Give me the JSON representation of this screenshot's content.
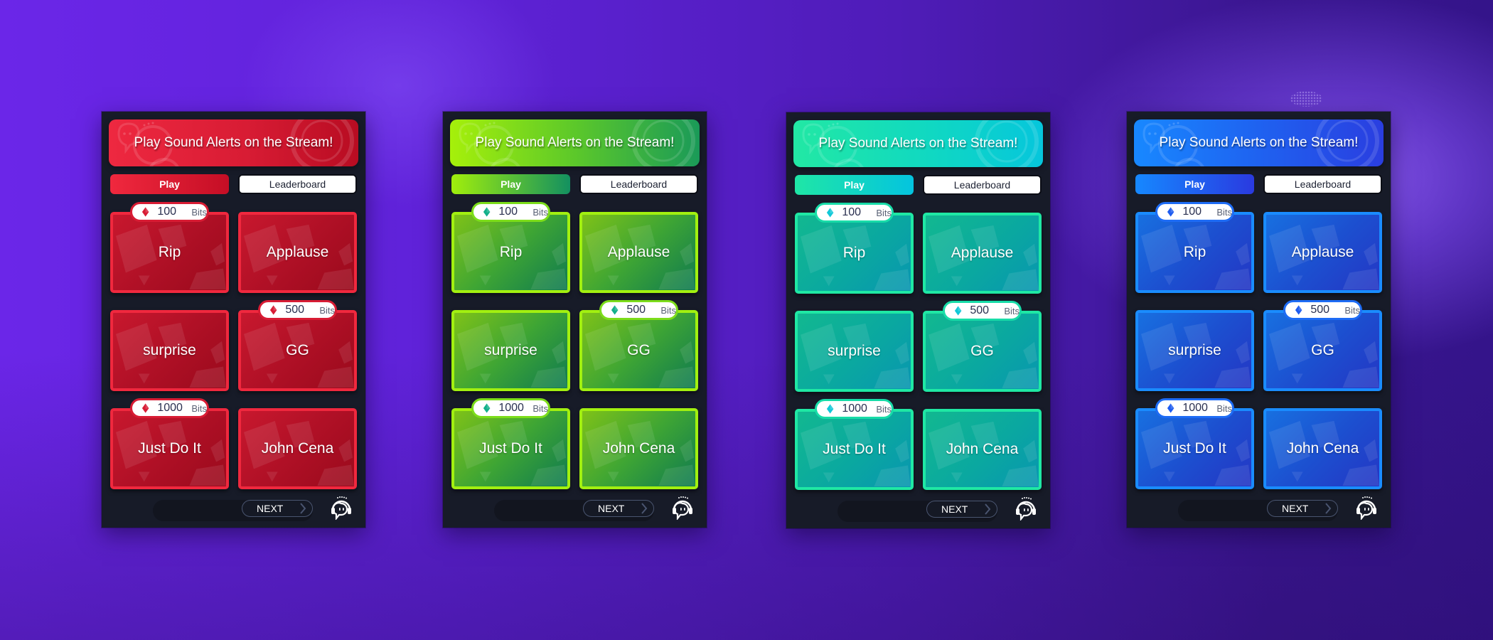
{
  "background": {
    "primary": "#6b26e8",
    "secondary": "#34148a"
  },
  "panels": [
    {
      "theme": "red",
      "accent": "#ee2840",
      "gem_color": "#d81c34",
      "banner_title": "Play Sound Alerts on the Stream!",
      "tabs": {
        "play": "Play",
        "leaderboard": "Leaderboard",
        "active": "play"
      },
      "alerts": [
        {
          "name": "Rip",
          "cost": "100",
          "unit": "Bits"
        },
        {
          "name": "Applause",
          "cost": null,
          "unit": null
        },
        {
          "name": "surprise",
          "cost": null,
          "unit": null
        },
        {
          "name": "GG",
          "cost": "500",
          "unit": "Bits"
        },
        {
          "name": "Just Do It",
          "cost": "1000",
          "unit": "Bits"
        },
        {
          "name": "John Cena",
          "cost": null,
          "unit": null
        }
      ],
      "next_label": "NEXT"
    },
    {
      "theme": "green",
      "accent": "#a6f00a",
      "gem_color": "#12b08a",
      "banner_title": "Play Sound Alerts on the Stream!",
      "tabs": {
        "play": "Play",
        "leaderboard": "Leaderboard",
        "active": "play"
      },
      "alerts": [
        {
          "name": "Rip",
          "cost": "100",
          "unit": "Bits"
        },
        {
          "name": "Applause",
          "cost": null,
          "unit": null
        },
        {
          "name": "surprise",
          "cost": null,
          "unit": null
        },
        {
          "name": "GG",
          "cost": "500",
          "unit": "Bits"
        },
        {
          "name": "Just Do It",
          "cost": "1000",
          "unit": "Bits"
        },
        {
          "name": "John Cena",
          "cost": null,
          "unit": null
        }
      ],
      "next_label": "NEXT"
    },
    {
      "theme": "teal",
      "accent": "#22e8a4",
      "gem_color": "#10c8d8",
      "banner_title": "Play Sound Alerts on the Stream!",
      "tabs": {
        "play": "Play",
        "leaderboard": "Leaderboard",
        "active": "play"
      },
      "alerts": [
        {
          "name": "Rip",
          "cost": "100",
          "unit": "Bits"
        },
        {
          "name": "Applause",
          "cost": null,
          "unit": null
        },
        {
          "name": "surprise",
          "cost": null,
          "unit": null
        },
        {
          "name": "GG",
          "cost": "500",
          "unit": "Bits"
        },
        {
          "name": "Just Do It",
          "cost": "1000",
          "unit": "Bits"
        },
        {
          "name": "John Cena",
          "cost": null,
          "unit": null
        }
      ],
      "next_label": "NEXT"
    },
    {
      "theme": "blue",
      "accent": "#1888ff",
      "gem_color": "#1e5cf0",
      "banner_title": "Play Sound Alerts on the Stream!",
      "tabs": {
        "play": "Play",
        "leaderboard": "Leaderboard",
        "active": "play"
      },
      "alerts": [
        {
          "name": "Rip",
          "cost": "100",
          "unit": "Bits"
        },
        {
          "name": "Applause",
          "cost": null,
          "unit": null
        },
        {
          "name": "surprise",
          "cost": null,
          "unit": null
        },
        {
          "name": "GG",
          "cost": "500",
          "unit": "Bits"
        },
        {
          "name": "Just Do It",
          "cost": "1000",
          "unit": "Bits"
        },
        {
          "name": "John Cena",
          "cost": null,
          "unit": null
        }
      ],
      "next_label": "NEXT"
    }
  ]
}
